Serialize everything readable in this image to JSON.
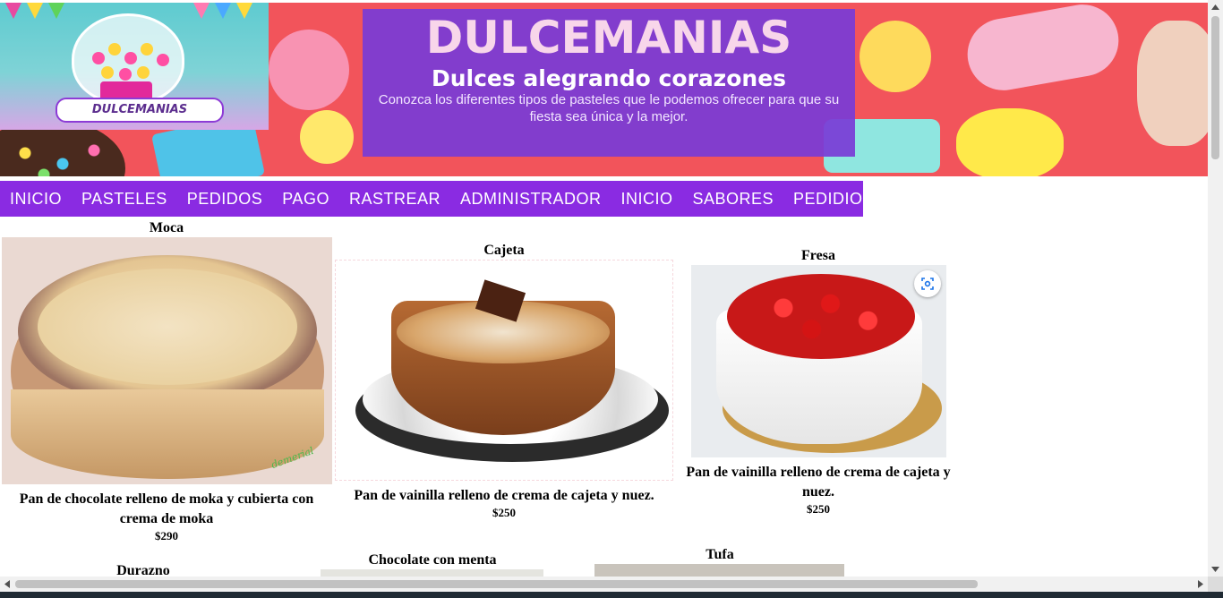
{
  "colors": {
    "nav_bg": "#8a2be2",
    "banner_bg": "#f2545b",
    "hero_box": "#7a3bd6"
  },
  "banner": {
    "logo_text": "DULCEMANIAS",
    "title": "DULCEMANIAS",
    "subtitle": "Dulces alegrando corazones",
    "description": "Conozca los diferentes tipos de pasteles que le podemos ofrecer para que su fiesta sea única y la mejor."
  },
  "nav": {
    "items": [
      {
        "label": "INICIO"
      },
      {
        "label": "PASTELES"
      },
      {
        "label": "PEDIDOS"
      },
      {
        "label": "PAGO"
      },
      {
        "label": "RASTREAR"
      },
      {
        "label": "ADMINISTRADOR"
      },
      {
        "label": "INICIO"
      },
      {
        "label": "SABORES"
      },
      {
        "label": "PEDIDIOS"
      }
    ]
  },
  "products": [
    {
      "name": "Moca",
      "description": "Pan de chocolate relleno de moka y cubierta con crema de moka",
      "price": "$290",
      "image_watermark": "demerial"
    },
    {
      "name": "Cajeta",
      "description": "Pan de vainilla relleno de crema de cajeta y nuez.",
      "price": "$250"
    },
    {
      "name": "Fresa",
      "description": "Pan de vainilla relleno de crema de cajeta y nuez.",
      "price": "$250"
    },
    {
      "name": "Durazno"
    },
    {
      "name": "Chocolate con menta"
    },
    {
      "name": "Tufa"
    }
  ],
  "icons": {
    "visual_search": "visual-search-icon",
    "scroll_up": "scroll-up-arrow-icon",
    "scroll_down": "scroll-down-arrow-icon",
    "scroll_left": "scroll-left-arrow-icon",
    "scroll_right": "scroll-right-arrow-icon"
  }
}
